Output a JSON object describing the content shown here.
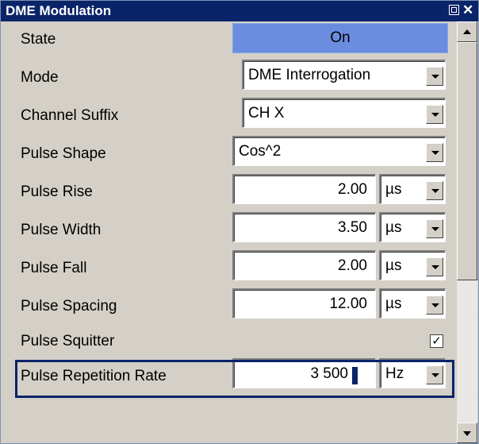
{
  "window": {
    "title": "DME Modulation"
  },
  "rows": {
    "state": {
      "label": "State",
      "value": "On"
    },
    "mode": {
      "label": "Mode",
      "value": "DME Interrogation"
    },
    "channel_suffix": {
      "label": "Channel Suffix",
      "value": "CH X"
    },
    "pulse_shape": {
      "label": "Pulse Shape",
      "value": "Cos^2"
    },
    "pulse_rise": {
      "label": "Pulse Rise",
      "value": "2.00",
      "unit": "µs"
    },
    "pulse_width": {
      "label": "Pulse Width",
      "value": "3.50",
      "unit": "µs"
    },
    "pulse_fall": {
      "label": "Pulse Fall",
      "value": "2.00",
      "unit": "µs"
    },
    "pulse_spacing": {
      "label": "Pulse Spacing",
      "value": "12.00",
      "unit": "µs"
    },
    "pulse_squitter": {
      "label": "Pulse Squitter",
      "checked": true
    },
    "pulse_repetition_rate": {
      "label": "Pulse Repetition Rate",
      "value": "3 500",
      "unit": "Hz"
    }
  },
  "icons": {
    "minimize": "window-restore-icon",
    "close": "close-icon",
    "dropdown": "chevron-down-icon",
    "check": "checkmark-icon"
  },
  "colors": {
    "titlebar": "#0a246a",
    "state_on": "#6b8de0",
    "panel_bg": "#d4d0c8"
  }
}
